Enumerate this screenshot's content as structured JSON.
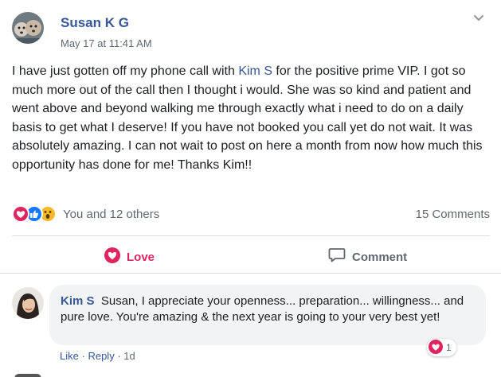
{
  "post": {
    "author": "Susan K G",
    "timestamp": "May 17 at 11:41 AM",
    "text_before_mention": "I have just gotten off my phone call with ",
    "mention": "Kim S",
    "text_after_mention": "  for the positive prime VIP. I got so much more out of the call then I thought i would. She was so kind and patient and went above and beyond walking me through exactly what i need to do on a daily basis to get what I deserve! If you have not booked you call yet do not wait. It was absolutely amazing. I can not wait to post on here a month from now how much this opportunity has done for me! Thanks Kim!!",
    "options_icon": "chevron-down-icon"
  },
  "reactions": {
    "icons": [
      "love-reaction-icon",
      "like-reaction-icon",
      "wow-reaction-icon"
    ],
    "summary": "You and 12 others",
    "comments_count": "15 Comments"
  },
  "actions": {
    "love_label": "Love",
    "comment_label": "Comment"
  },
  "comment": {
    "author": "Kim S",
    "text": "Susan, I appreciate your openness... preparation... willingness... and pure love. You're amazing & the next year is going to your very best yet!",
    "reaction_count": "1",
    "like_label": "Like",
    "reply_label": "Reply",
    "separator": "·",
    "time": "1d"
  },
  "colors": {
    "link_blue": "#385898",
    "love_red": "#e0245e",
    "like_blue": "#1877f2",
    "wow_yellow": "#f7b928",
    "muted_gray": "#606770",
    "bubble_bg": "#f2f3f5"
  }
}
